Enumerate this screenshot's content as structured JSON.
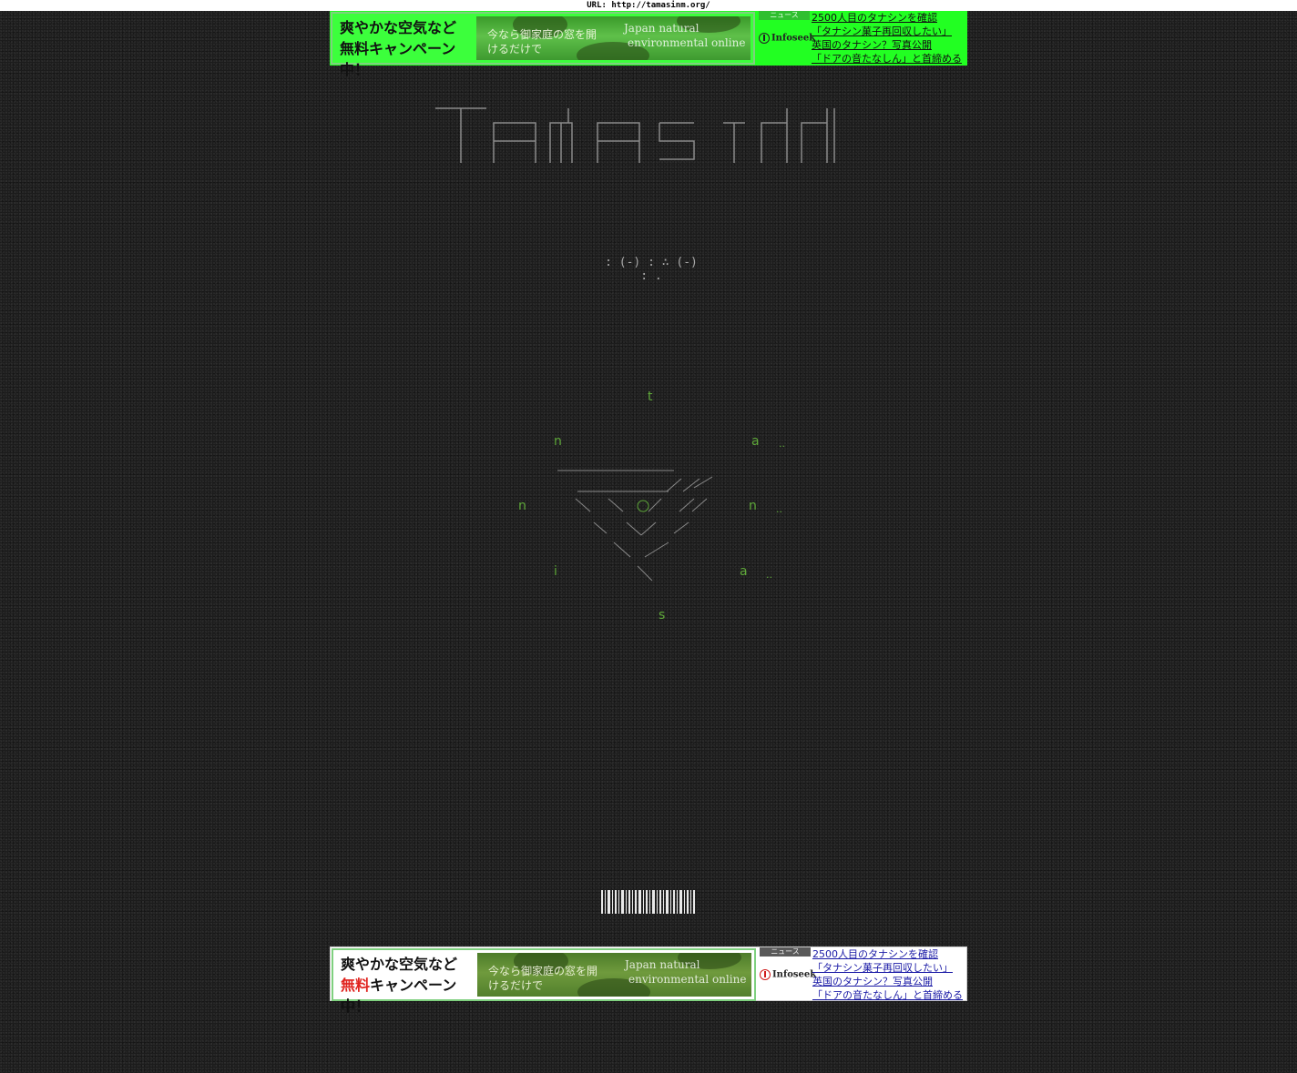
{
  "url_bar": {
    "text": "URL: http://tamasinm.org/"
  },
  "ads": [
    {
      "banner_line1": "爽やかな空気など",
      "banner_free": "無料",
      "banner_line2_rest": "キャンペーン中！",
      "banner_message": "今なら御家庭の窓を開けるだけで",
      "banner_brand1": "Japan natural",
      "banner_brand2": "environmental online",
      "news_tab": "ニュース",
      "news_logo": "Infoseek",
      "news_items": [
        "2500人目のタナシンを確認",
        "「タナシン菓子再回収したい」",
        "英国のタナシン？写真公開",
        "「ドアの音たなしん」と首締める"
      ]
    },
    {
      "banner_line1": "爽やかな空気など",
      "banner_free": "無料",
      "banner_line2_rest": "キャンペーン中！",
      "banner_message": "今なら御家庭の窓を開けるだけで",
      "banner_brand1": "Japan natural",
      "banner_brand2": "environmental online",
      "news_tab": "ニュース",
      "news_logo": "Infoseek",
      "news_items": [
        "2500人目のタナシンを確認",
        "「タナシン菓子再回収したい」",
        "英国のタナシン？写真公開",
        "「ドアの音たなしん」と首締める"
      ]
    }
  ],
  "smiley": ": (-) : ∴ (-) : .",
  "letters": {
    "t": "t",
    "n1": "n",
    "a1": "a",
    "n2": "n",
    "n3": "n",
    "i": "i",
    "a2": "a",
    "s": "s"
  },
  "dots": {
    "d1": "..",
    "d2": "..",
    "d3": ".."
  },
  "colors": {
    "accent_green": "#5fa83a",
    "ad_green": "#22ff22",
    "background": "#1c1c1c"
  },
  "icons": {
    "center": "circle-icon",
    "logo": "infoseek-logo-icon"
  }
}
